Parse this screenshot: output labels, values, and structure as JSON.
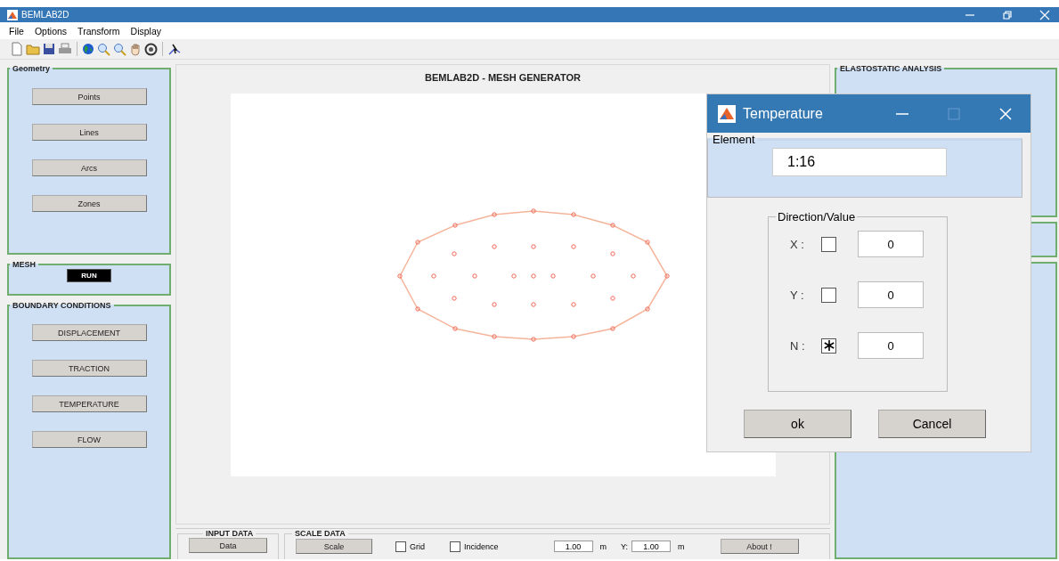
{
  "window": {
    "title": "BEMLAB2D"
  },
  "menu": [
    "File",
    "Options",
    "Transform",
    "Display"
  ],
  "geometry": {
    "title": "Geometry",
    "buttons": [
      "Points",
      "Lines",
      "Arcs",
      "Zones"
    ]
  },
  "mesh": {
    "title": "MESH",
    "button": "RUN"
  },
  "boundary_conditions": {
    "title": "BOUNDARY CONDITIONS",
    "buttons": [
      "DISPLACEMENT",
      "TRACTION",
      "TEMPERATURE",
      "FLOW"
    ]
  },
  "plot": {
    "title": "BEMLAB2D - MESH GENERATOR"
  },
  "input_data": {
    "title": "INPUT DATA",
    "button": "Data"
  },
  "scale_data": {
    "title": "SCALE DATA",
    "button": "Scale",
    "checkboxes": [
      {
        "label": "Grid",
        "checked": false
      },
      {
        "label": "Incidence",
        "checked": false
      }
    ],
    "x_value": "1.00",
    "x_unit": "m",
    "y_label": "Y:",
    "y_value": "1.00",
    "y_unit": "m",
    "about_button": "About !"
  },
  "analysis": {
    "title": "ELASTOSTATIC ANALYSIS"
  },
  "dialog": {
    "title": "Temperature",
    "element": {
      "label": "Element",
      "value": "1:16"
    },
    "direction_value": {
      "title": "Direction/Value",
      "rows": [
        {
          "label": "X :",
          "checked": false,
          "value": "0"
        },
        {
          "label": "Y :",
          "checked": false,
          "value": "0"
        },
        {
          "label": "N :",
          "checked": true,
          "value": "0"
        }
      ]
    },
    "buttons": [
      "ok",
      "Cancel"
    ]
  }
}
